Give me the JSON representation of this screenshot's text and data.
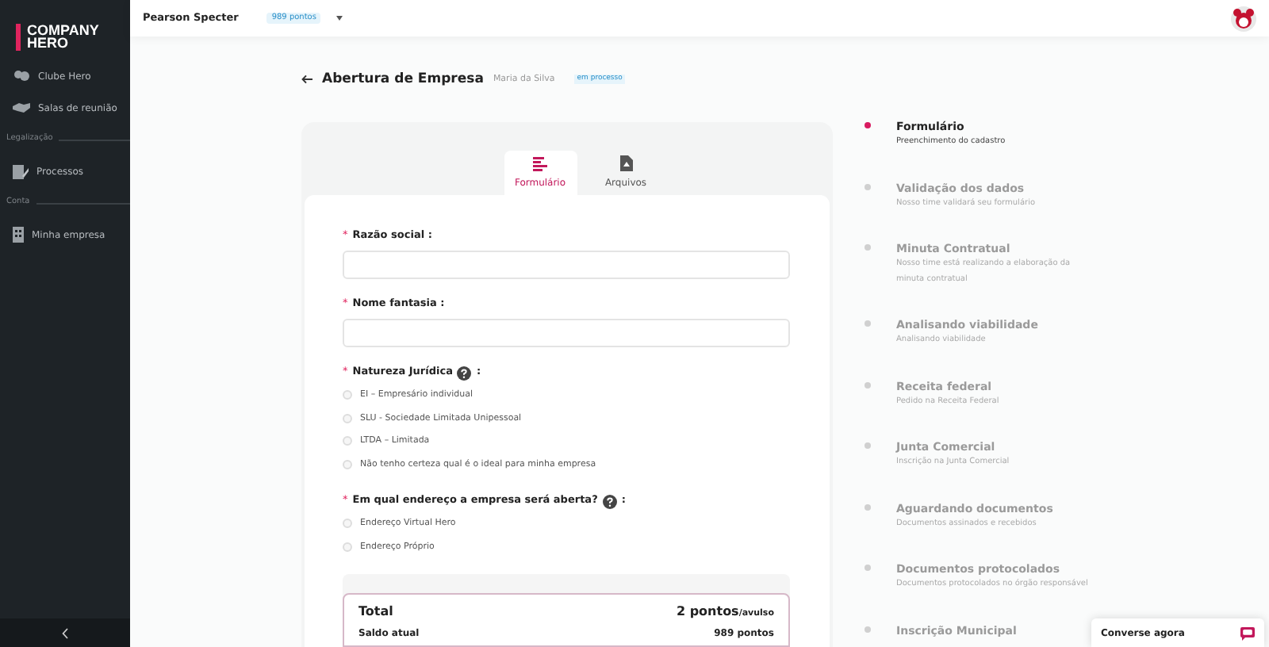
{
  "sidebar": {
    "logo": [
      "COMPANY",
      "HERO"
    ],
    "sections": [
      {
        "items": [
          {
            "label": "Clube Hero"
          },
          {
            "label": "Salas de reunião"
          }
        ]
      },
      {
        "title": "Legalização",
        "items": [
          {
            "label": "Processos"
          }
        ]
      },
      {
        "title": "Conta",
        "items": [
          {
            "label": "Minha empresa"
          }
        ]
      }
    ]
  },
  "topbar": {
    "user": "Pearson Specter",
    "points": "989 pontos"
  },
  "header": {
    "title": "Abertura de Empresa",
    "client": "Maria da Silva",
    "status": "em processo"
  },
  "tabs": [
    {
      "label": "Formulário",
      "selected": true
    },
    {
      "label": "Arquivos",
      "selected": false
    }
  ],
  "form": {
    "fields": [
      {
        "kind": "text",
        "marker": "*",
        "label": "Razão social :"
      },
      {
        "kind": "text",
        "marker": "*",
        "label": "Nome fantasia :"
      },
      {
        "kind": "radio",
        "marker": "*",
        "label": "Natureza Jurídica",
        "help": true,
        "suffix": ":",
        "options": [
          {
            "label": "EI – Empresário individual",
            "selected": false
          },
          {
            "label": "SLU - Sociedade Limitada Unipessoal",
            "selected": false
          },
          {
            "label": "LTDA – Limitada",
            "selected": false
          },
          {
            "label": "Não tenho certeza qual é o ideal para minha empresa",
            "selected": false
          }
        ]
      },
      {
        "kind": "radio",
        "marker": "*",
        "label": "Em qual endereço a empresa será aberta?",
        "help": true,
        "suffix": ":",
        "options": [
          {
            "label": "Endereço Virtual Hero",
            "selected": false
          },
          {
            "label": "Endereço Próprio",
            "selected": false
          }
        ]
      }
    ]
  },
  "summary": {
    "total_label": "Total",
    "total_value": "2 pontos",
    "total_unit": "/avulso",
    "balance_label": "Saldo atual",
    "balance_value": "989 pontos"
  },
  "steps": [
    {
      "title": "Formulário",
      "description": "Preenchimento do cadastro",
      "selected": true
    },
    {
      "title": "Validação dos dados",
      "description": "Nosso time validará seu formulário",
      "selected": false
    },
    {
      "title": "Minuta Contratual",
      "description": "Nosso time está realizando a elaboração da minuta contratual",
      "selected": false
    },
    {
      "title": "Analisando viabilidade",
      "description": "Analisando viabilidade",
      "selected": false
    },
    {
      "title": "Receita federal",
      "description": "Pedido na Receita Federal",
      "selected": false
    },
    {
      "title": "Junta Comercial",
      "description": "Inscrição na Junta Comercial",
      "selected": false
    },
    {
      "title": "Aguardando documentos",
      "description": "Documentos assinados e recebidos",
      "selected": false
    },
    {
      "title": "Documentos protocolados",
      "description": "Documentos protocolados no órgão responsável",
      "selected": false
    },
    {
      "title": "Inscrição Municipal",
      "selected": false
    }
  ],
  "chat": {
    "label": "Converse agora"
  }
}
